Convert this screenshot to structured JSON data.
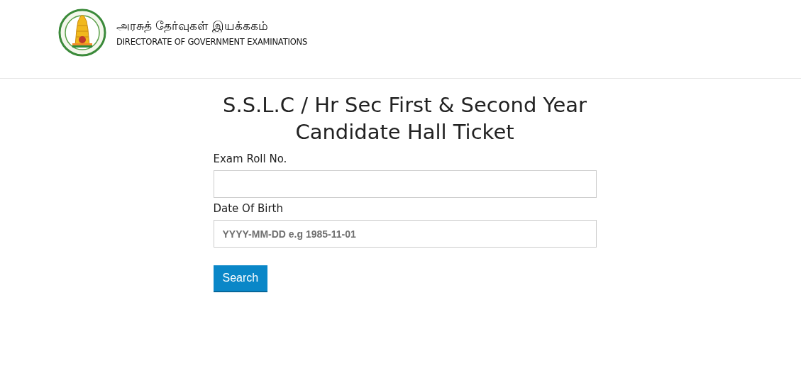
{
  "header": {
    "title_tamil": "அரசுத் தேர்வுகள் இயக்ககம்",
    "title_english": "DIRECTORATE OF GOVERNMENT EXAMINATIONS"
  },
  "form": {
    "heading": "S.S.L.C / Hr Sec First & Second Year Candidate Hall Ticket",
    "fields": [
      {
        "label": "Exam Roll No."
      },
      {
        "label": "Date Of Birth",
        "placeholder": "YYYY-MM-DD e.g 1985-11-01"
      }
    ],
    "button": "Search"
  }
}
